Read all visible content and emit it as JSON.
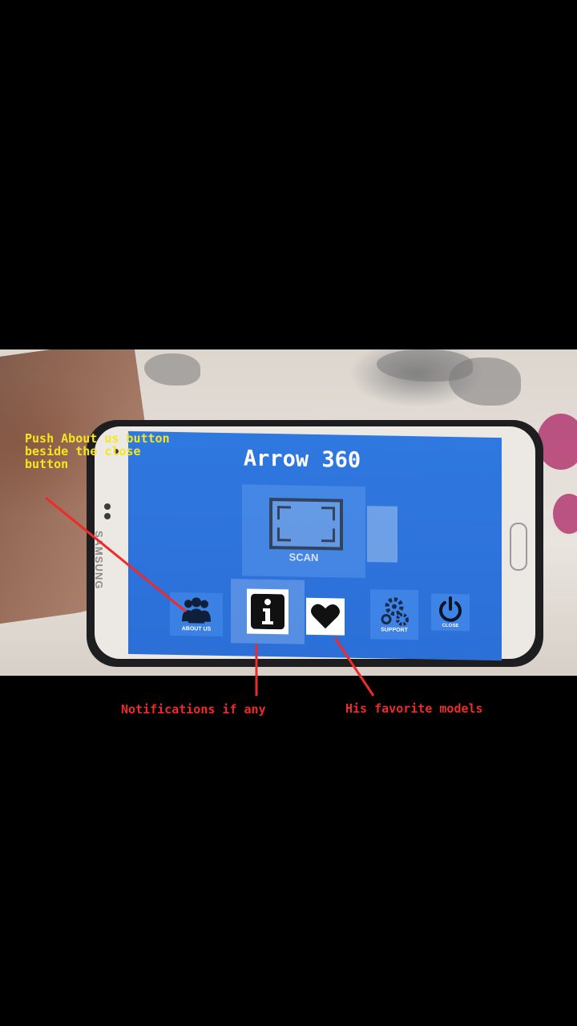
{
  "app": {
    "title": "Arrow 360",
    "scan_label": "SCAN",
    "menu": [
      {
        "id": "about",
        "label": "ABOUT US",
        "icon": "people-group-icon"
      },
      {
        "id": "info",
        "label": "",
        "icon": "info-icon"
      },
      {
        "id": "favorites",
        "label": "",
        "icon": "heart-icon"
      },
      {
        "id": "support",
        "label": "SUPPORT",
        "icon": "gears-icon"
      },
      {
        "id": "close",
        "label": "CLOSE",
        "icon": "power-icon"
      }
    ]
  },
  "device": {
    "brand": "SAMSUNG"
  },
  "annotations": {
    "about_hint": "Push About us button\nbeside the close\nbutton",
    "info_hint": "Notifications if any",
    "favorites_hint": "His favorite models"
  },
  "colors": {
    "screen_blue": "#2f78e0",
    "annotation_yellow": "#f5e61e",
    "annotation_red": "#ee2a2a"
  }
}
